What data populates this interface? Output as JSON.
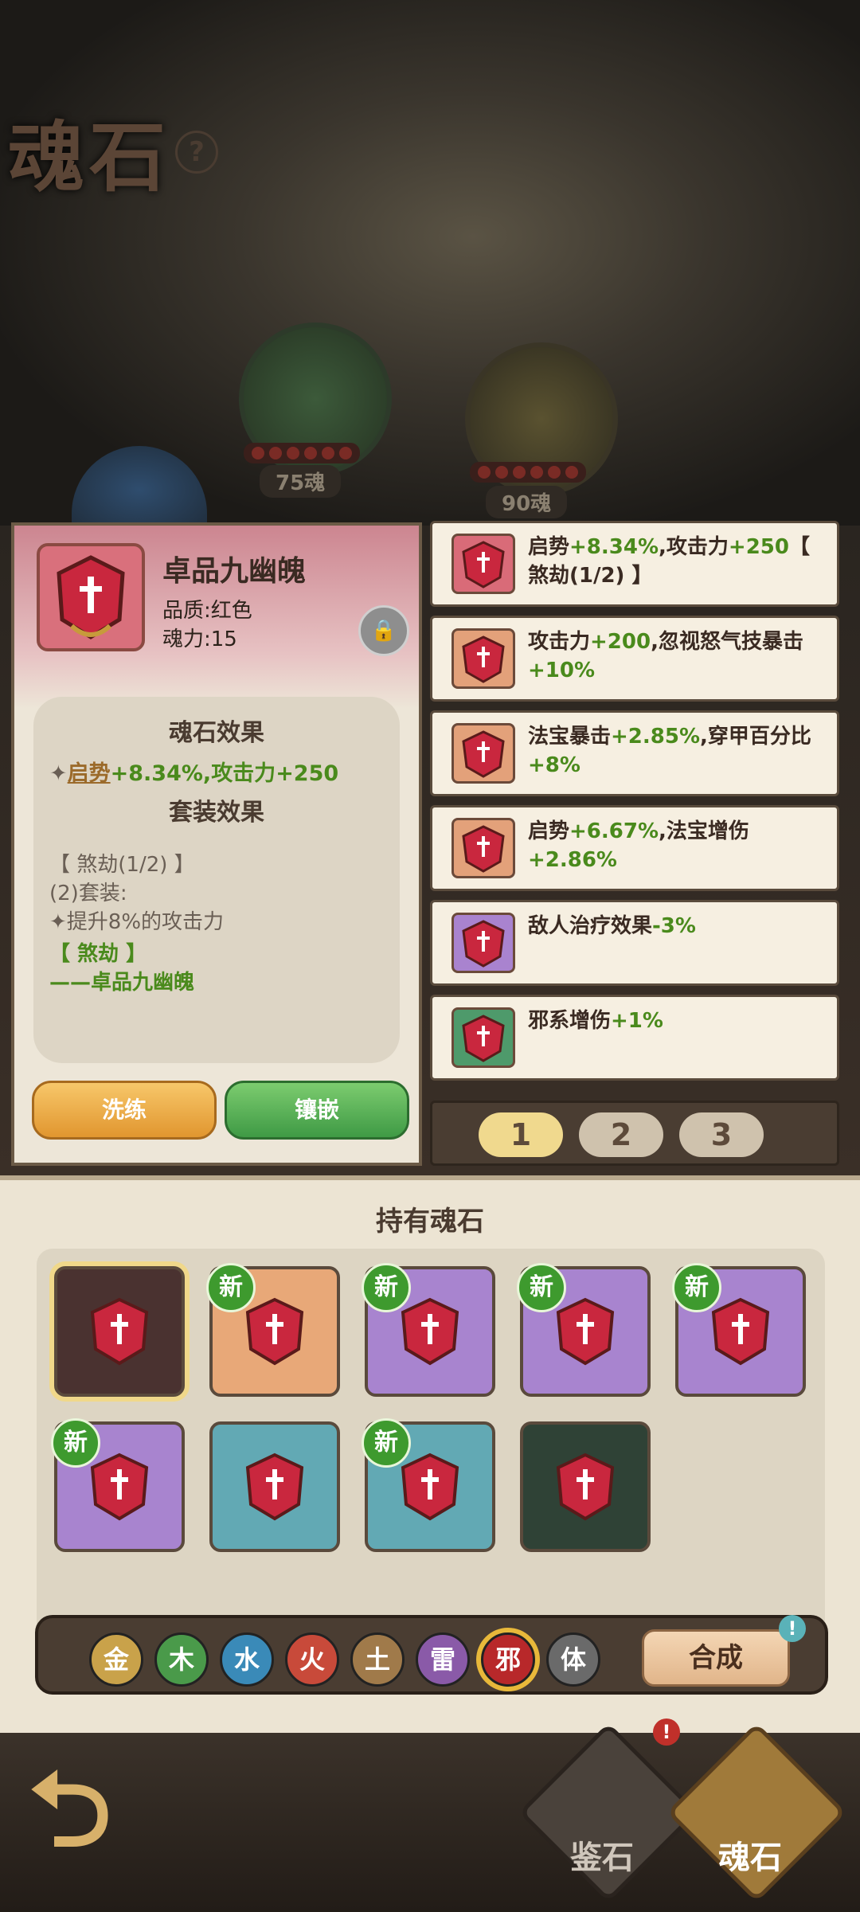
{
  "header": {
    "title": "魂石",
    "help": "?"
  },
  "orbs": [
    {
      "label": "75魂"
    },
    {
      "label": "90魂"
    }
  ],
  "detail": {
    "name": "卓品九幽魄",
    "quality": "品质:红色",
    "power": "魂力:15",
    "effect_title": "魂石效果",
    "effect_stat1": "启势",
    "effect_val1": "+8.34%,",
    "effect_stat2": "攻击力",
    "effect_val2": "+250",
    "set_title": "套装效果",
    "set_name": "【 煞劫(1/2) 】",
    "set_count": "(2)套装:",
    "set_bonus": "提升8%的攻击力",
    "set_tag": "【 煞劫 】",
    "set_member": "——卓品九幽魄",
    "wash_label": "洗练",
    "inlay_label": "镶嵌"
  },
  "right_list": [
    {
      "l1": "启势",
      "v1": "+8.34%",
      "l2": ",攻击力",
      "v2": "+250",
      "l3": "【 煞劫(1/2) 】",
      "color": "#d96b78"
    },
    {
      "l1": "攻击力",
      "v1": "+200",
      "l2": ",忽视怒气技暴击",
      "v2": "+10%",
      "l3": "",
      "color": "#e3a17a"
    },
    {
      "l1": "法宝暴击",
      "v1": "+2.85%",
      "l2": ",穿甲百分比",
      "v2": "+8%",
      "l3": "",
      "color": "#e3a17a"
    },
    {
      "l1": "启势",
      "v1": "+6.67%",
      "l2": ",法宝增伤",
      "v2": "+2.86%",
      "l3": "",
      "color": "#e3a17a"
    },
    {
      "l1": "敌人治疗效果",
      "v1": "-3%",
      "l2": "",
      "v2": "",
      "l3": "",
      "color": "#a983cf"
    },
    {
      "l1": "邪系增伤",
      "v1": "+1%",
      "l2": "",
      "v2": "",
      "l3": "",
      "color": "#4e9a6b"
    }
  ],
  "pages": [
    "1",
    "2",
    "3"
  ],
  "inventory": {
    "title": "持有魂石",
    "new_label": "新",
    "slots": [
      {
        "color": "#4a3230",
        "new": false,
        "selected": true
      },
      {
        "color": "#e8a878",
        "new": true
      },
      {
        "color": "#a884cf",
        "new": true
      },
      {
        "color": "#a884cf",
        "new": true
      },
      {
        "color": "#a884cf",
        "new": true
      },
      {
        "color": "#a884cf",
        "new": true
      },
      {
        "color": "#62a9b4",
        "new": false
      },
      {
        "color": "#62a9b4",
        "new": true
      },
      {
        "color": "#2f4236",
        "new": false
      }
    ]
  },
  "filters": [
    "金",
    "木",
    "水",
    "火",
    "土",
    "雷",
    "邪",
    "体"
  ],
  "combine_label": "合成",
  "nav": {
    "appraise": "鉴石",
    "soulstone": "魂石"
  }
}
